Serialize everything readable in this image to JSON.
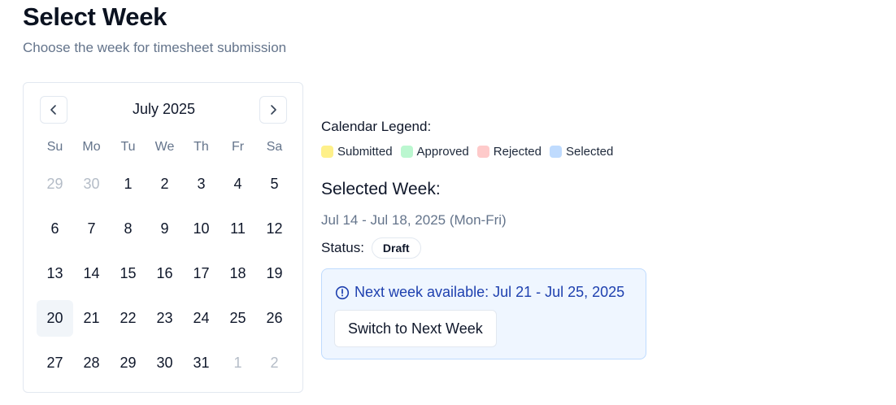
{
  "header": {
    "title": "Select Week",
    "subtitle": "Choose the week for timesheet submission"
  },
  "calendar": {
    "month_label": "July 2025",
    "prev_icon": "chevron-left-icon",
    "next_icon": "chevron-right-icon",
    "weekdays": [
      "Su",
      "Mo",
      "Tu",
      "We",
      "Th",
      "Fr",
      "Sa"
    ],
    "days": [
      {
        "label": "29",
        "outside": true
      },
      {
        "label": "30",
        "outside": true
      },
      {
        "label": "1"
      },
      {
        "label": "2"
      },
      {
        "label": "3"
      },
      {
        "label": "4"
      },
      {
        "label": "5"
      },
      {
        "label": "6"
      },
      {
        "label": "7"
      },
      {
        "label": "8"
      },
      {
        "label": "9"
      },
      {
        "label": "10"
      },
      {
        "label": "11"
      },
      {
        "label": "12"
      },
      {
        "label": "13"
      },
      {
        "label": "14"
      },
      {
        "label": "15"
      },
      {
        "label": "16"
      },
      {
        "label": "17"
      },
      {
        "label": "18"
      },
      {
        "label": "19"
      },
      {
        "label": "20",
        "today": true
      },
      {
        "label": "21"
      },
      {
        "label": "22"
      },
      {
        "label": "23"
      },
      {
        "label": "24"
      },
      {
        "label": "25"
      },
      {
        "label": "26"
      },
      {
        "label": "27"
      },
      {
        "label": "28"
      },
      {
        "label": "29"
      },
      {
        "label": "30"
      },
      {
        "label": "31"
      },
      {
        "label": "1",
        "outside": true
      },
      {
        "label": "2",
        "outside": true
      }
    ]
  },
  "legend": {
    "title": "Calendar Legend:",
    "items": [
      {
        "label": "Submitted",
        "color": "#fef08a"
      },
      {
        "label": "Approved",
        "color": "#bbf7d0"
      },
      {
        "label": "Rejected",
        "color": "#fecaca"
      },
      {
        "label": "Selected",
        "color": "#bfdbfe"
      }
    ]
  },
  "selection": {
    "title": "Selected Week:",
    "range": "Jul 14 - Jul 18, 2025 (Mon-Fri)",
    "status_label": "Status:",
    "status_value": "Draft"
  },
  "notice": {
    "icon": "info-circle-icon",
    "text": "Next week available: Jul 21 - Jul 25, 2025",
    "button_label": "Switch to Next Week"
  }
}
